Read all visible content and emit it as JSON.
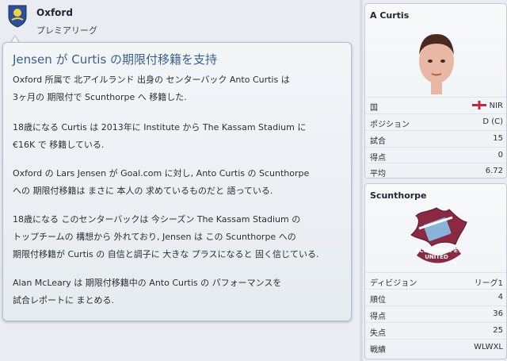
{
  "header": {
    "club_name": "Oxford",
    "league": "プレミアリーグ"
  },
  "news": {
    "headline": "Jensen が Curtis の期限付移籍を支持",
    "paragraphs": [
      [
        "Oxford 所属で 北アイルランド 出身の センターバック Anto Curtis は",
        "3ヶ月の 期限付で Scunthorpe へ 移籍した."
      ],
      [
        "18歳になる Curtis は 2013年に Institute から The Kassam Stadium に",
        "€16K で 移籍している."
      ],
      [
        "Oxford の Lars Jensen が Goal.com に対し, Anto Curtis の Scunthorpe",
        "への 期限付移籍は まさに 本人の 求めているものだと 語っている."
      ],
      [
        "18歳になる このセンターバックは 今シーズン The Kassam Stadium の",
        "トップチームの 構想から 外れており, Jensen は この Scunthorpe への",
        "期限付移籍が Curtis の 自信と調子に 大きな プラスになると 固く信じている."
      ],
      [
        "Alan McLeary は 期限付移籍中の Anto Curtis の パフォーマンスを",
        "試合レポートに まとめる."
      ]
    ]
  },
  "player": {
    "name": "A Curtis",
    "stats": [
      {
        "label": "国",
        "value": "NIR"
      },
      {
        "label": "ポジション",
        "value": "D (C)"
      },
      {
        "label": "試合",
        "value": "15"
      },
      {
        "label": "得点",
        "value": "0"
      },
      {
        "label": "平均",
        "value": "6.72"
      }
    ]
  },
  "club": {
    "name": "Scunthorpe",
    "crest_text": "SCUNTHORPE UNITED",
    "stats": [
      {
        "label": "ディビジョン",
        "value": "リーグ1"
      },
      {
        "label": "順位",
        "value": "4"
      },
      {
        "label": "得点",
        "value": "36"
      },
      {
        "label": "失点",
        "value": "25"
      },
      {
        "label": "戦績",
        "value": "WLWXL"
      }
    ]
  },
  "colors": {
    "headline": "#3a5f8a",
    "oxford_crest": "#2d4f9a",
    "scunthorpe_claret": "#8b2942",
    "scunthorpe_blue": "#8ab3da"
  }
}
